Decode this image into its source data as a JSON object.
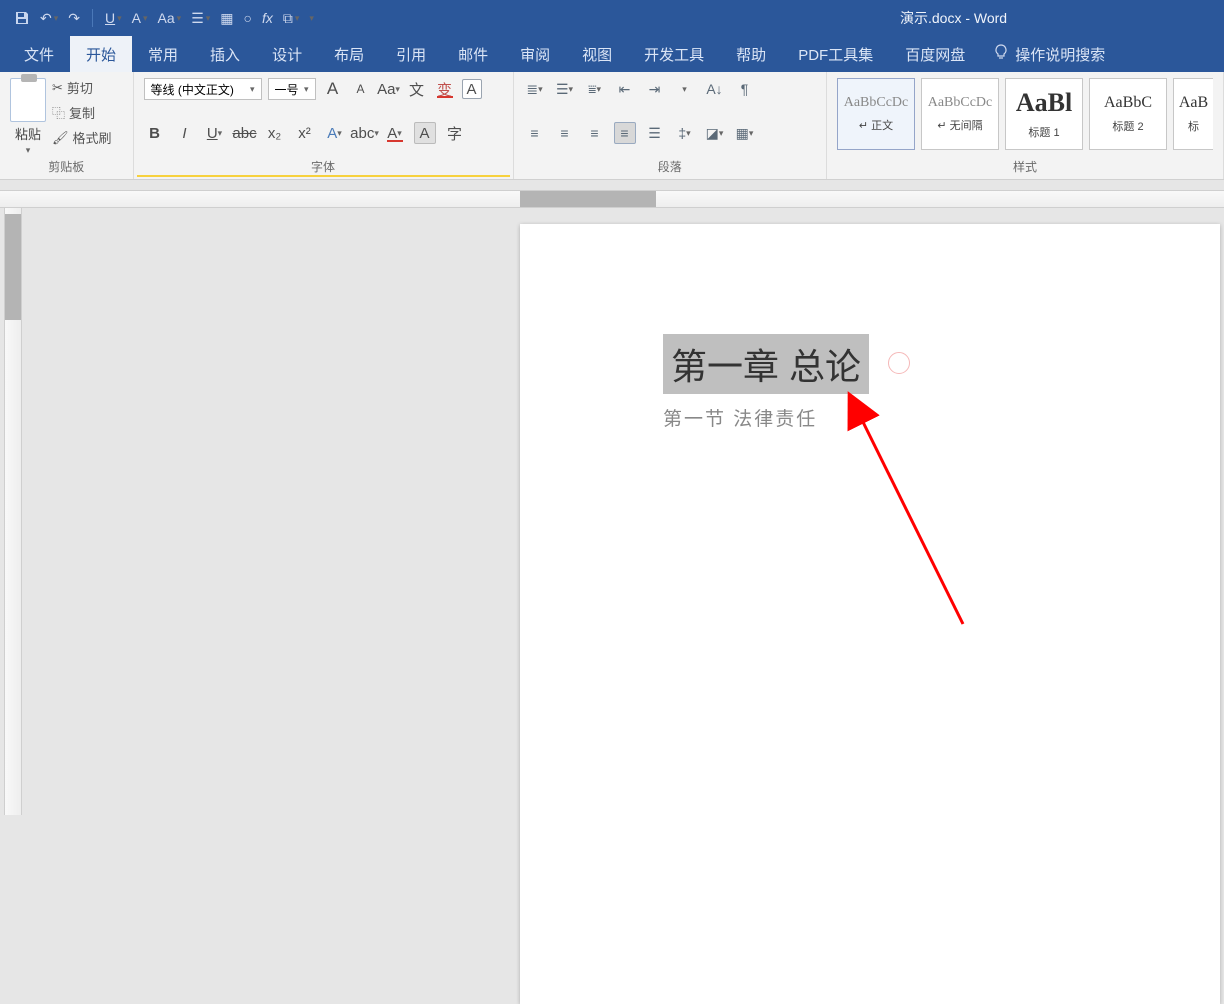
{
  "title": "演示.docx - Word",
  "qat": {
    "underline": "U",
    "fontStyle": "A",
    "caseBtn": "Aa",
    "fx": "fx"
  },
  "tabs": [
    "文件",
    "开始",
    "常用",
    "插入",
    "设计",
    "布局",
    "引用",
    "邮件",
    "审阅",
    "视图",
    "开发工具",
    "帮助",
    "PDF工具集",
    "百度网盘"
  ],
  "activeTab": "开始",
  "tellMe": "操作说明搜索",
  "clipboard": {
    "paste": "粘贴",
    "cut": "剪切",
    "copy": "复制",
    "formatPainter": "格式刷",
    "groupLabel": "剪贴板"
  },
  "font": {
    "nameValue": "等线 (中文正文)",
    "sizeValue": "一号",
    "grow": "A",
    "shrink": "A",
    "caseBtn": "Aa",
    "phonetic": "文",
    "clearFmt": "A",
    "bold": "B",
    "italic": "I",
    "underline": "U",
    "strike": "abc",
    "sub": "x₂",
    "sup": "x²",
    "textEffect": "A",
    "highlight": "abc",
    "fontColor": "A",
    "shading": "A",
    "enclose": "字",
    "groupLabel": "字体"
  },
  "paragraph": {
    "groupLabel": "段落"
  },
  "styles": {
    "cells": [
      {
        "preview": "AaBbCcDc",
        "label": "↵ 正文"
      },
      {
        "preview": "AaBbCcDc",
        "label": "↵ 无间隔"
      },
      {
        "preview": "AaBl",
        "label": "标题 1"
      },
      {
        "preview": "AaBbC",
        "label": "标题 2"
      },
      {
        "preview": "AaB",
        "label": "标"
      }
    ],
    "groupLabel": "样式"
  },
  "document": {
    "heading": "第一章  总论",
    "subheading": "第一节  法律责任"
  },
  "rulerStart": "L"
}
